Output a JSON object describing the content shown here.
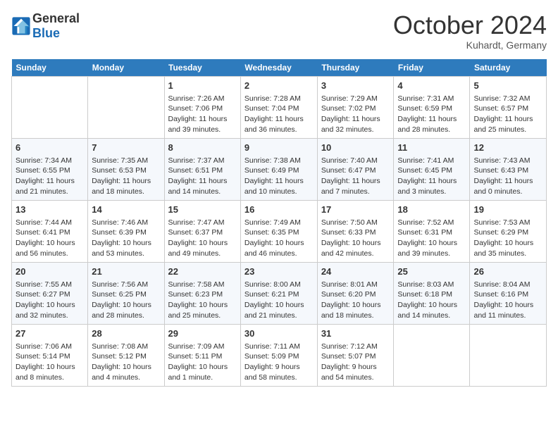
{
  "header": {
    "logo_line1": "General",
    "logo_line2": "Blue",
    "month_title": "October 2024",
    "location": "Kuhardt, Germany"
  },
  "weekdays": [
    "Sunday",
    "Monday",
    "Tuesday",
    "Wednesday",
    "Thursday",
    "Friday",
    "Saturday"
  ],
  "weeks": [
    [
      {
        "date": "",
        "sunrise": "",
        "sunset": "",
        "daylight": ""
      },
      {
        "date": "",
        "sunrise": "",
        "sunset": "",
        "daylight": ""
      },
      {
        "date": "1",
        "sunrise": "Sunrise: 7:26 AM",
        "sunset": "Sunset: 7:06 PM",
        "daylight": "Daylight: 11 hours and 39 minutes."
      },
      {
        "date": "2",
        "sunrise": "Sunrise: 7:28 AM",
        "sunset": "Sunset: 7:04 PM",
        "daylight": "Daylight: 11 hours and 36 minutes."
      },
      {
        "date": "3",
        "sunrise": "Sunrise: 7:29 AM",
        "sunset": "Sunset: 7:02 PM",
        "daylight": "Daylight: 11 hours and 32 minutes."
      },
      {
        "date": "4",
        "sunrise": "Sunrise: 7:31 AM",
        "sunset": "Sunset: 6:59 PM",
        "daylight": "Daylight: 11 hours and 28 minutes."
      },
      {
        "date": "5",
        "sunrise": "Sunrise: 7:32 AM",
        "sunset": "Sunset: 6:57 PM",
        "daylight": "Daylight: 11 hours and 25 minutes."
      }
    ],
    [
      {
        "date": "6",
        "sunrise": "Sunrise: 7:34 AM",
        "sunset": "Sunset: 6:55 PM",
        "daylight": "Daylight: 11 hours and 21 minutes."
      },
      {
        "date": "7",
        "sunrise": "Sunrise: 7:35 AM",
        "sunset": "Sunset: 6:53 PM",
        "daylight": "Daylight: 11 hours and 18 minutes."
      },
      {
        "date": "8",
        "sunrise": "Sunrise: 7:37 AM",
        "sunset": "Sunset: 6:51 PM",
        "daylight": "Daylight: 11 hours and 14 minutes."
      },
      {
        "date": "9",
        "sunrise": "Sunrise: 7:38 AM",
        "sunset": "Sunset: 6:49 PM",
        "daylight": "Daylight: 11 hours and 10 minutes."
      },
      {
        "date": "10",
        "sunrise": "Sunrise: 7:40 AM",
        "sunset": "Sunset: 6:47 PM",
        "daylight": "Daylight: 11 hours and 7 minutes."
      },
      {
        "date": "11",
        "sunrise": "Sunrise: 7:41 AM",
        "sunset": "Sunset: 6:45 PM",
        "daylight": "Daylight: 11 hours and 3 minutes."
      },
      {
        "date": "12",
        "sunrise": "Sunrise: 7:43 AM",
        "sunset": "Sunset: 6:43 PM",
        "daylight": "Daylight: 11 hours and 0 minutes."
      }
    ],
    [
      {
        "date": "13",
        "sunrise": "Sunrise: 7:44 AM",
        "sunset": "Sunset: 6:41 PM",
        "daylight": "Daylight: 10 hours and 56 minutes."
      },
      {
        "date": "14",
        "sunrise": "Sunrise: 7:46 AM",
        "sunset": "Sunset: 6:39 PM",
        "daylight": "Daylight: 10 hours and 53 minutes."
      },
      {
        "date": "15",
        "sunrise": "Sunrise: 7:47 AM",
        "sunset": "Sunset: 6:37 PM",
        "daylight": "Daylight: 10 hours and 49 minutes."
      },
      {
        "date": "16",
        "sunrise": "Sunrise: 7:49 AM",
        "sunset": "Sunset: 6:35 PM",
        "daylight": "Daylight: 10 hours and 46 minutes."
      },
      {
        "date": "17",
        "sunrise": "Sunrise: 7:50 AM",
        "sunset": "Sunset: 6:33 PM",
        "daylight": "Daylight: 10 hours and 42 minutes."
      },
      {
        "date": "18",
        "sunrise": "Sunrise: 7:52 AM",
        "sunset": "Sunset: 6:31 PM",
        "daylight": "Daylight: 10 hours and 39 minutes."
      },
      {
        "date": "19",
        "sunrise": "Sunrise: 7:53 AM",
        "sunset": "Sunset: 6:29 PM",
        "daylight": "Daylight: 10 hours and 35 minutes."
      }
    ],
    [
      {
        "date": "20",
        "sunrise": "Sunrise: 7:55 AM",
        "sunset": "Sunset: 6:27 PM",
        "daylight": "Daylight: 10 hours and 32 minutes."
      },
      {
        "date": "21",
        "sunrise": "Sunrise: 7:56 AM",
        "sunset": "Sunset: 6:25 PM",
        "daylight": "Daylight: 10 hours and 28 minutes."
      },
      {
        "date": "22",
        "sunrise": "Sunrise: 7:58 AM",
        "sunset": "Sunset: 6:23 PM",
        "daylight": "Daylight: 10 hours and 25 minutes."
      },
      {
        "date": "23",
        "sunrise": "Sunrise: 8:00 AM",
        "sunset": "Sunset: 6:21 PM",
        "daylight": "Daylight: 10 hours and 21 minutes."
      },
      {
        "date": "24",
        "sunrise": "Sunrise: 8:01 AM",
        "sunset": "Sunset: 6:20 PM",
        "daylight": "Daylight: 10 hours and 18 minutes."
      },
      {
        "date": "25",
        "sunrise": "Sunrise: 8:03 AM",
        "sunset": "Sunset: 6:18 PM",
        "daylight": "Daylight: 10 hours and 14 minutes."
      },
      {
        "date": "26",
        "sunrise": "Sunrise: 8:04 AM",
        "sunset": "Sunset: 6:16 PM",
        "daylight": "Daylight: 10 hours and 11 minutes."
      }
    ],
    [
      {
        "date": "27",
        "sunrise": "Sunrise: 7:06 AM",
        "sunset": "Sunset: 5:14 PM",
        "daylight": "Daylight: 10 hours and 8 minutes."
      },
      {
        "date": "28",
        "sunrise": "Sunrise: 7:08 AM",
        "sunset": "Sunset: 5:12 PM",
        "daylight": "Daylight: 10 hours and 4 minutes."
      },
      {
        "date": "29",
        "sunrise": "Sunrise: 7:09 AM",
        "sunset": "Sunset: 5:11 PM",
        "daylight": "Daylight: 10 hours and 1 minute."
      },
      {
        "date": "30",
        "sunrise": "Sunrise: 7:11 AM",
        "sunset": "Sunset: 5:09 PM",
        "daylight": "Daylight: 9 hours and 58 minutes."
      },
      {
        "date": "31",
        "sunrise": "Sunrise: 7:12 AM",
        "sunset": "Sunset: 5:07 PM",
        "daylight": "Daylight: 9 hours and 54 minutes."
      },
      {
        "date": "",
        "sunrise": "",
        "sunset": "",
        "daylight": ""
      },
      {
        "date": "",
        "sunrise": "",
        "sunset": "",
        "daylight": ""
      }
    ]
  ]
}
